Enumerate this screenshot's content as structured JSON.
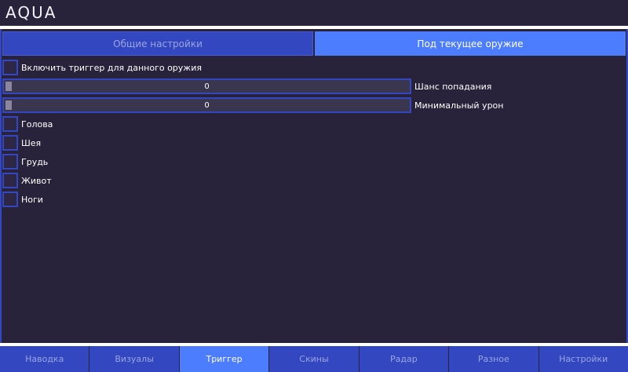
{
  "app": {
    "title": "AQUA"
  },
  "subtabs": [
    {
      "label": "Общие настройки",
      "active": false
    },
    {
      "label": "Под текущее оружие",
      "active": true
    }
  ],
  "trigger": {
    "enable_label": "Включить триггер для данного оружия",
    "enable_checked": false,
    "hit_chance": {
      "label": "Шанс попадания",
      "value": "0"
    },
    "min_damage": {
      "label": "Минимальный урон",
      "value": "0"
    },
    "hitboxes": [
      {
        "label": "Голова",
        "checked": false
      },
      {
        "label": "Шея",
        "checked": false
      },
      {
        "label": "Грудь",
        "checked": false
      },
      {
        "label": "Живот",
        "checked": false
      },
      {
        "label": "Ноги",
        "checked": false
      }
    ]
  },
  "nav": {
    "tabs": [
      {
        "label": "Наводка",
        "active": false
      },
      {
        "label": "Визуалы",
        "active": false
      },
      {
        "label": "Триггер",
        "active": true
      },
      {
        "label": "Скины",
        "active": false
      },
      {
        "label": "Радар",
        "active": false
      },
      {
        "label": "Разное",
        "active": false
      },
      {
        "label": "Настройки",
        "active": false
      }
    ]
  },
  "colors": {
    "background": "#28223a",
    "accent": "#3347c0",
    "accent_active": "#4d7dff",
    "inactive_text": "#9aa4e0"
  }
}
